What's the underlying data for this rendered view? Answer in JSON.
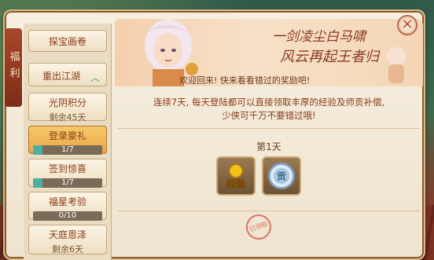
{
  "window": {
    "side_tab": "福利",
    "close": "×"
  },
  "menu": {
    "items": [
      {
        "label": "探宝画卷"
      },
      {
        "label": "重出江湖",
        "chevron": "︿"
      },
      {
        "label": "光阴积分",
        "sub": "剩余45天"
      },
      {
        "label": "登录豪礼",
        "progress_text": "1/7",
        "progress": 0.14
      },
      {
        "label": "签到惊喜",
        "progress_text": "1/7",
        "progress": 0.14
      },
      {
        "label": "福星考验",
        "progress_text": "0/10",
        "progress": 0
      },
      {
        "label": "天庭恩泽",
        "sub": "剩余6天"
      }
    ]
  },
  "banner": {
    "motto_line1": "一剑凌尘白马啸",
    "motto_line2": "风云再起王者归",
    "welcome": "欢迎回来! 快来看看错过的奖励吧!"
  },
  "main": {
    "description_line1": "连续7天, 每天登陆都可以直接领取丰厚的经验及师贡补偿,",
    "description_line2": "少侠可千万不要错过哦!",
    "day_label": "第1天",
    "rewards": [
      {
        "name": "经验",
        "icon": "experience-icon",
        "color": "#f2c21a"
      },
      {
        "name": "贡",
        "icon": "contribution-coin-icon",
        "color": "#a9c7de"
      }
    ],
    "claimed_stamp": "已领取"
  }
}
